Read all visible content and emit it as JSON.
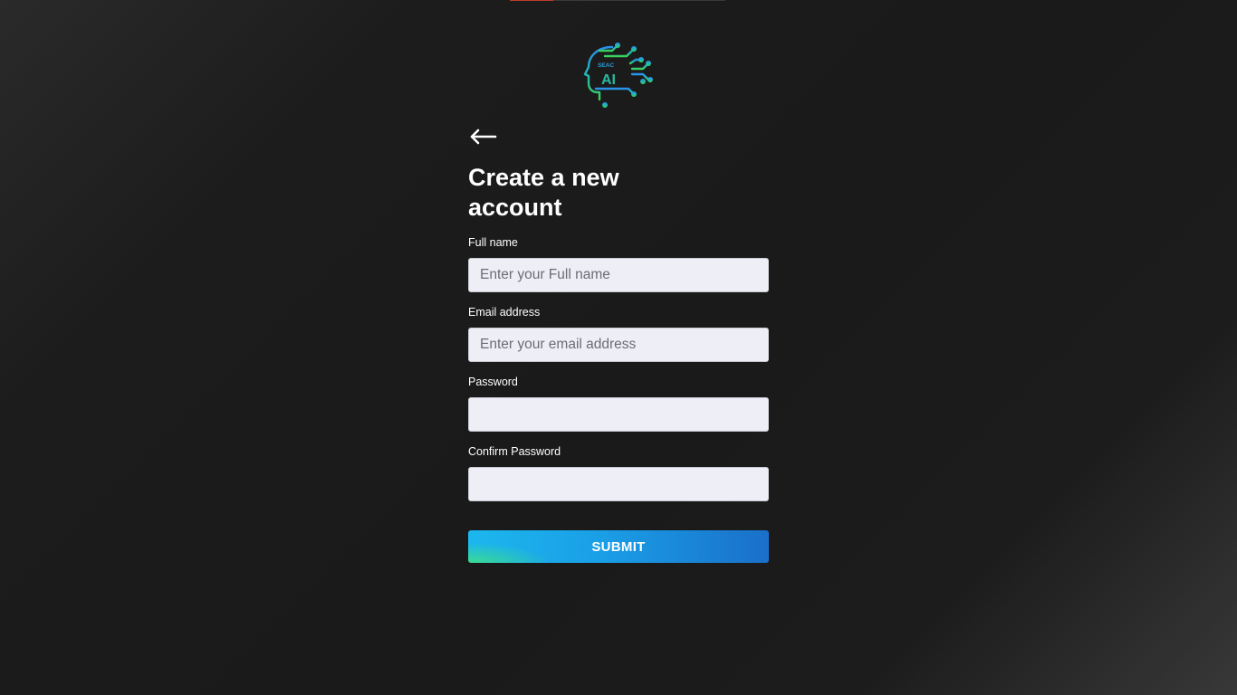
{
  "logo": {
    "icon": "ai-head-circuit-logo",
    "top_text": "SEAC",
    "main_text": "AI"
  },
  "nav": {
    "back_icon": "arrow-left-icon"
  },
  "form": {
    "title": "Create a new account",
    "fields": [
      {
        "label": "Full name",
        "placeholder": "Enter your Full name",
        "value": ""
      },
      {
        "label": "Email address",
        "placeholder": "Enter your email address",
        "value": ""
      },
      {
        "label": "Password",
        "placeholder": "",
        "value": ""
      },
      {
        "label": "Confirm Password",
        "placeholder": "",
        "value": ""
      }
    ],
    "submit_label": "SUBMIT"
  },
  "colors": {
    "background": "#1a1a1a",
    "input_bg": "#eeeef6",
    "button_start": "#1cb7ee",
    "button_end": "#1a6fc9",
    "button_accent": "#3cdc8c",
    "logo_blue": "#1e90ff",
    "logo_green": "#2ecc71"
  }
}
